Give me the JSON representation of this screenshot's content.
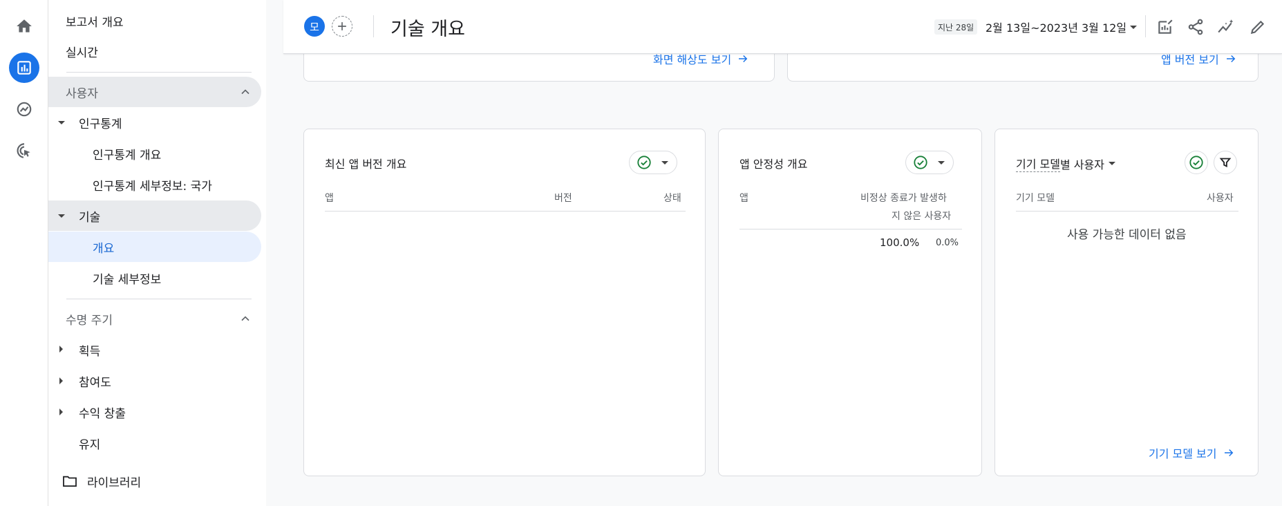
{
  "rail": {
    "items": [
      {
        "icon": "home-icon"
      },
      {
        "icon": "reports-icon",
        "active": true
      },
      {
        "icon": "explore-icon"
      },
      {
        "icon": "advertising-icon"
      }
    ]
  },
  "nav": {
    "reports_overview": "보고서 개요",
    "realtime": "실시간",
    "users_section": "사용자",
    "demographics": "인구통계",
    "demographics_overview": "인구통계 개요",
    "demographic_details": "인구통계 세부정보: 국가",
    "tech": "기술",
    "tech_overview": "개요",
    "tech_details": "기술 세부정보",
    "lifecycle_section": "수명 주기",
    "acquisition": "획득",
    "engagement": "참여도",
    "monetization": "수익 창출",
    "retention": "유지",
    "library": "라이브러리"
  },
  "header": {
    "avatar_letter": "모",
    "title": "기술 개요",
    "date_chip": "지난 28일",
    "date_range": "2월 13일~2023년 3월 12일"
  },
  "top_cards": {
    "screen_resolution_link": "화면 해상도 보기",
    "app_version_link": "앱 버전 보기"
  },
  "card_latest_version": {
    "title": "최신 앱 버전 개요",
    "col_app": "앱",
    "col_version": "버전",
    "col_status": "상태"
  },
  "card_stability": {
    "title": "앱 안정성 개요",
    "col_app": "앱",
    "col_crash_free_line1": "비정상 종료가 발생하",
    "col_crash_free_line2": "지 않은 사용자",
    "value_main": "100.0%",
    "value_change": "0.0%"
  },
  "card_device_model": {
    "title_part1": "기기 모델",
    "title_part2": " 별 사용자",
    "col_device": "기기 모델",
    "col_users": "사용자",
    "empty_text": "사용 가능한 데이터 없음",
    "link": "기기 모델 보기"
  },
  "colors": {
    "accent": "#1a73e8",
    "success": "#188038",
    "nav_selected_bg": "#e8f0fe",
    "nav_group_bg": "#e8eaed"
  }
}
